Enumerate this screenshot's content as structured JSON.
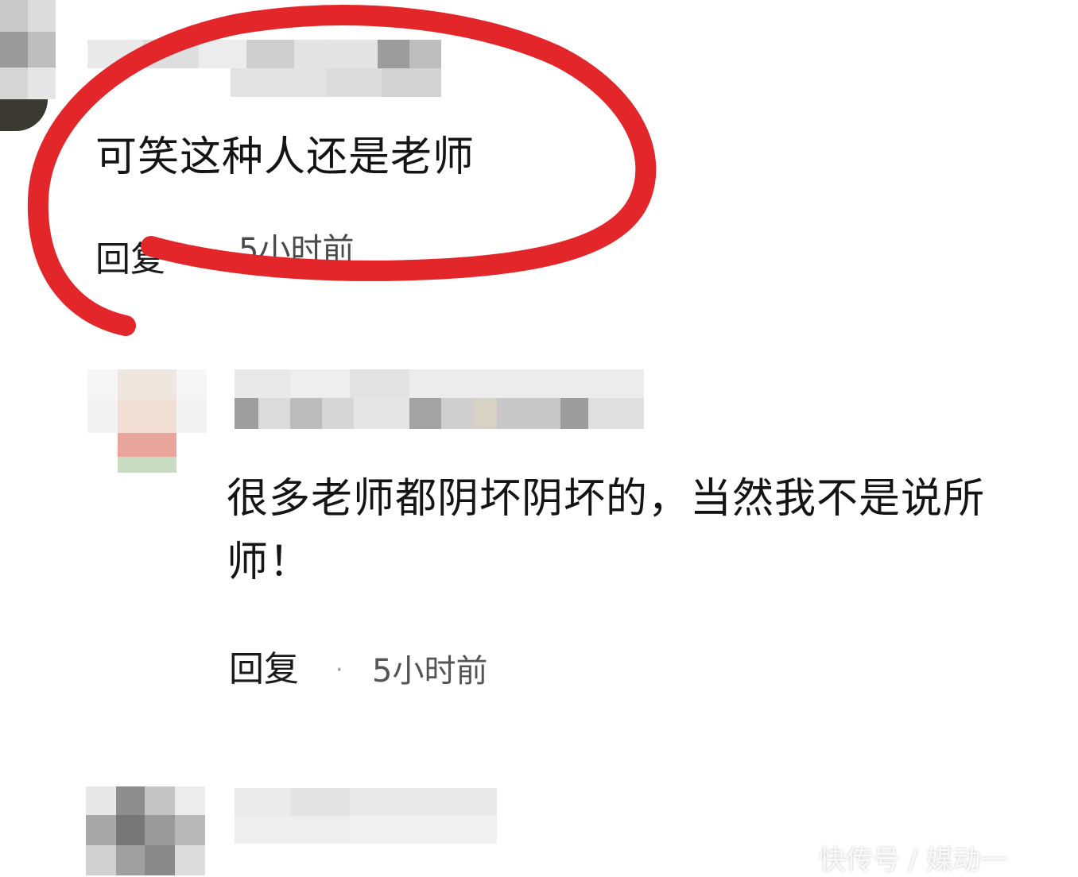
{
  "comments": [
    {
      "text": "可笑这种人还是老师",
      "reply_label": "回复",
      "time": "5小时前"
    },
    {
      "text_line1": "很多老师都阴坏阴坏的，当然我不是说所",
      "text_line2": "师！",
      "reply_label": "回复",
      "separator": "·",
      "time": "5小时前"
    }
  ],
  "watermark": "快传号 / 媒动一",
  "colors": {
    "highlight": "#e3262a",
    "text": "#141414",
    "muted": "#555555"
  },
  "annotation": {
    "shape": "red-hand-drawn-circle"
  }
}
